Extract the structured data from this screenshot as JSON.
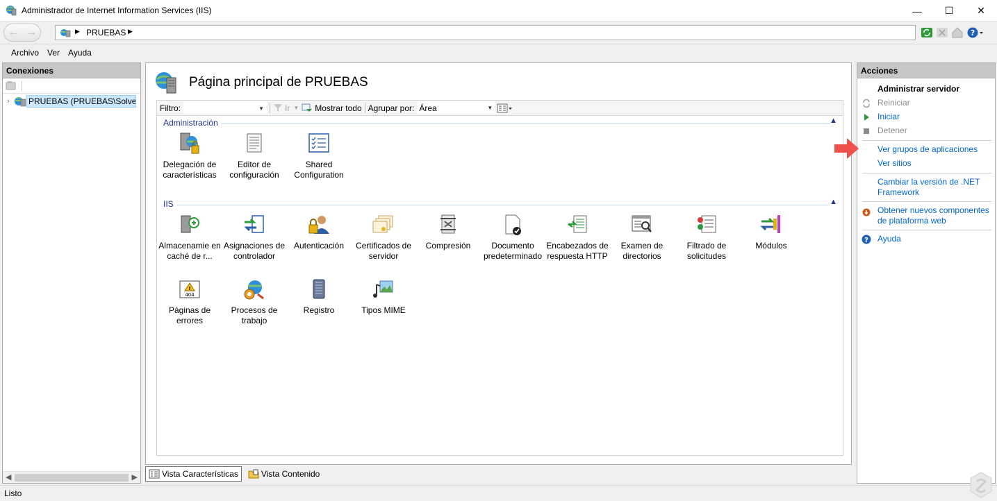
{
  "window": {
    "title": "Administrador de Internet Information Services (IIS)",
    "minimize": "—",
    "maximize": "☐",
    "close": "✕"
  },
  "address": {
    "crumb": "PRUEBAS"
  },
  "menu": [
    "Archivo",
    "Ver",
    "Ayuda"
  ],
  "connections": {
    "header": "Conexiones",
    "tree": [
      {
        "label": "PRUEBAS (PRUEBAS\\Solvetic)",
        "icon": "server-icon"
      }
    ]
  },
  "main": {
    "title": "Página principal de PRUEBAS",
    "filter": {
      "label": "Filtro:",
      "go_label": "Ir",
      "show_all_label": "Mostrar todo",
      "group_by_label": "Agrupar por:",
      "group_by_value": "Área"
    },
    "groups": [
      {
        "name": "Administración",
        "items": [
          {
            "label": "Delegación de características",
            "icon": "feature-delegation-icon"
          },
          {
            "label": "Editor de configuración",
            "icon": "configuration-editor-icon"
          },
          {
            "label": "Shared Configuration",
            "icon": "shared-configuration-icon"
          }
        ]
      },
      {
        "name": "IIS",
        "items": [
          {
            "label": "Almacenamie en caché de r...",
            "icon": "output-caching-icon"
          },
          {
            "label": "Asignaciones de controlador",
            "icon": "handler-mappings-icon"
          },
          {
            "label": "Autenticación",
            "icon": "authentication-icon"
          },
          {
            "label": "Certificados de servidor",
            "icon": "server-certificates-icon"
          },
          {
            "label": "Compresión",
            "icon": "compression-icon"
          },
          {
            "label": "Documento predeterminado",
            "icon": "default-document-icon"
          },
          {
            "label": "Encabezados de respuesta HTTP",
            "icon": "http-response-headers-icon"
          },
          {
            "label": "Examen de directorios",
            "icon": "directory-browsing-icon"
          },
          {
            "label": "Filtrado de solicitudes",
            "icon": "request-filtering-icon"
          },
          {
            "label": "Módulos",
            "icon": "modules-icon"
          },
          {
            "label": "Páginas de errores",
            "icon": "error-pages-icon"
          },
          {
            "label": "Procesos de trabajo",
            "icon": "worker-processes-icon"
          },
          {
            "label": "Registro",
            "icon": "logging-icon"
          },
          {
            "label": "Tipos MIME",
            "icon": "mime-types-icon"
          }
        ]
      }
    ],
    "tabs": [
      {
        "label": "Vista Características",
        "active": true
      },
      {
        "label": "Vista Contenido",
        "active": false
      }
    ]
  },
  "actions": {
    "header": "Acciones",
    "section_title": "Administrar servidor",
    "items": [
      {
        "label": "Reiniciar",
        "state": "disabled",
        "icon": "restart-icon"
      },
      {
        "label": "Iniciar",
        "state": "link",
        "icon": "start-icon"
      },
      {
        "label": "Detener",
        "state": "disabled",
        "icon": "stop-icon"
      },
      {
        "label": "Ver grupos de aplicaciones",
        "state": "link"
      },
      {
        "label": "Ver sitios",
        "state": "link"
      },
      {
        "label": "Cambiar la versión de .NET Framework",
        "state": "link"
      },
      {
        "label": "Obtener nuevos componentes de plataforma web",
        "state": "link",
        "icon": "web-platform-icon"
      },
      {
        "label": "Ayuda",
        "state": "link",
        "icon": "help-icon"
      }
    ]
  },
  "status": {
    "text": "Listo"
  },
  "colors": {
    "link": "#0066cc",
    "group_heading": "#1e3287",
    "panel_header": "#c6c6c6",
    "annotation_arrow": "#f0504a"
  }
}
